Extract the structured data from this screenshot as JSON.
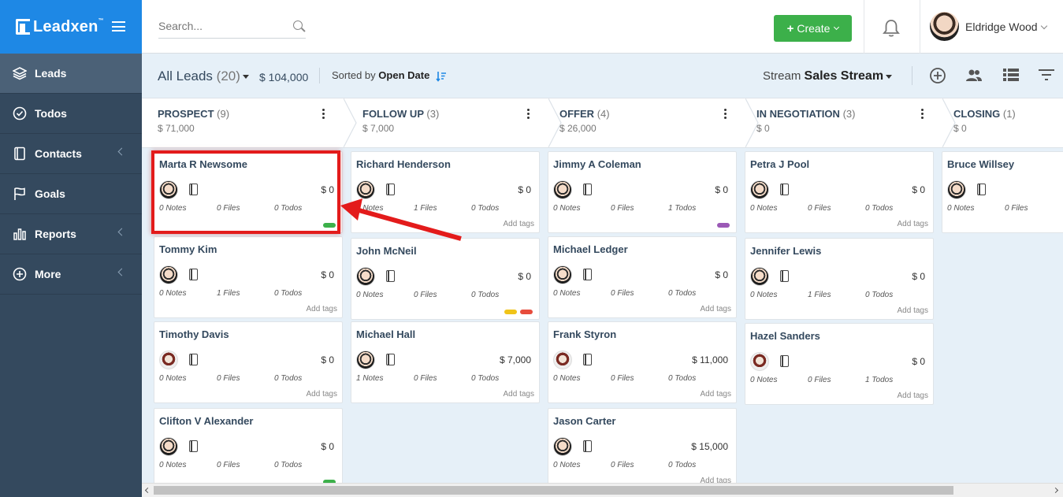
{
  "brand": {
    "name": "Leadxen",
    "tm": "™"
  },
  "sidebar": {
    "items": [
      {
        "label": "Leads",
        "icon": "layers-icon",
        "active": true
      },
      {
        "label": "Todos",
        "icon": "check-circle-icon"
      },
      {
        "label": "Contacts",
        "icon": "address-book-icon"
      },
      {
        "label": "Goals",
        "icon": "flag-icon"
      },
      {
        "label": "Reports",
        "icon": "bar-chart-icon"
      },
      {
        "label": "More",
        "icon": "plus-circle-icon"
      }
    ]
  },
  "topbar": {
    "search_placeholder": "Search...",
    "create_label": "Create",
    "user_name": "Eldridge Wood"
  },
  "toolbar": {
    "view_label": "All Leads",
    "view_count": "(20)",
    "total": "$ 104,000",
    "sorted_prefix": "Sorted by",
    "sorted_field": "Open Date",
    "stream_prefix": "Stream",
    "stream_name": "Sales Stream"
  },
  "stages": [
    {
      "title": "PROSPECT",
      "count": "(9)",
      "amount": "$ 71,000"
    },
    {
      "title": "FOLLOW UP",
      "count": "(3)",
      "amount": "$ 7,000"
    },
    {
      "title": "OFFER",
      "count": "(4)",
      "amount": "$ 26,000"
    },
    {
      "title": "IN NEGOTIATION",
      "count": "(3)",
      "amount": "$ 0"
    },
    {
      "title": "CLOSING",
      "count": "(1)",
      "amount": "$ 0"
    }
  ],
  "labels": {
    "add_tags": "Add tags"
  },
  "columns": [
    [
      {
        "name": "Marta R Newsome",
        "amount": "$ 0",
        "notes": "0 Notes",
        "files": "0 Files",
        "todos": "0 Todos",
        "tags": [
          "#3cb04a"
        ],
        "add_tags": false
      },
      {
        "name": "Tommy Kim",
        "amount": "$ 0",
        "notes": "0 Notes",
        "files": "1 Files",
        "todos": "0 Todos",
        "tags": [],
        "add_tags": true
      },
      {
        "name": "Timothy Davis",
        "amount": "$ 0",
        "notes": "0 Notes",
        "files": "0 Files",
        "todos": "0 Todos",
        "tags": [],
        "add_tags": true,
        "alt": true
      },
      {
        "name": "Clifton V Alexander",
        "amount": "$ 0",
        "notes": "0 Notes",
        "files": "0 Files",
        "todos": "0 Todos",
        "tags": [
          "#3cb04a"
        ],
        "add_tags": false
      }
    ],
    [
      {
        "name": "Richard Henderson",
        "amount": "$ 0",
        "notes": "0 Notes",
        "files": "1 Files",
        "todos": "0 Todos",
        "tags": [],
        "add_tags": true
      },
      {
        "name": "John McNeil",
        "amount": "$ 0",
        "notes": "0 Notes",
        "files": "0 Files",
        "todos": "0 Todos",
        "tags": [
          "#f0c419",
          "#e74c3c"
        ],
        "add_tags": false
      },
      {
        "name": "Michael Hall",
        "amount": "$ 7,000",
        "notes": "1 Notes",
        "files": "0 Files",
        "todos": "0 Todos",
        "tags": [],
        "add_tags": true
      }
    ],
    [
      {
        "name": "Jimmy A Coleman",
        "amount": "$ 0",
        "notes": "0 Notes",
        "files": "0 Files",
        "todos": "1 Todos",
        "tags": [
          "#9b59b6"
        ],
        "add_tags": false
      },
      {
        "name": "Michael Ledger",
        "amount": "$ 0",
        "notes": "0 Notes",
        "files": "0 Files",
        "todos": "0 Todos",
        "tags": [],
        "add_tags": true
      },
      {
        "name": "Frank Styron",
        "amount": "$ 11,000",
        "notes": "0 Notes",
        "files": "0 Files",
        "todos": "0 Todos",
        "tags": [],
        "add_tags": true,
        "alt": true
      },
      {
        "name": "Jason Carter",
        "amount": "$ 15,000",
        "notes": "0 Notes",
        "files": "0 Files",
        "todos": "0 Todos",
        "tags": [],
        "add_tags": true
      }
    ],
    [
      {
        "name": "Petra J Pool",
        "amount": "$ 0",
        "notes": "0 Notes",
        "files": "0 Files",
        "todos": "0 Todos",
        "tags": [],
        "add_tags": true
      },
      {
        "name": "Jennifer Lewis",
        "amount": "$ 0",
        "notes": "0 Notes",
        "files": "1 Files",
        "todos": "0 Todos",
        "tags": [],
        "add_tags": true
      },
      {
        "name": "Hazel Sanders",
        "amount": "$ 0",
        "notes": "0 Notes",
        "files": "0 Files",
        "todos": "1 Todos",
        "tags": [],
        "add_tags": true,
        "alt": true
      }
    ],
    [
      {
        "name": "Bruce Willsey",
        "amount": "",
        "notes": "0 Notes",
        "files": "0 Files",
        "todos": "",
        "tags": [],
        "add_tags": false
      }
    ]
  ]
}
